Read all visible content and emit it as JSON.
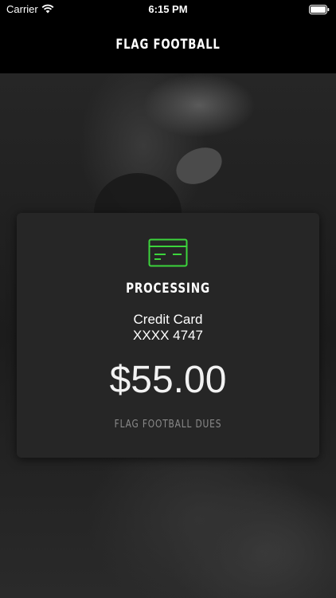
{
  "status_bar": {
    "carrier": "Carrier",
    "time": "6:15 PM",
    "wifi_icon": "wifi-icon",
    "battery_icon": "battery-icon"
  },
  "nav": {
    "title": "FLAG FOOTBALL"
  },
  "payment": {
    "icon": "credit-card-icon",
    "icon_color": "#3cd43c",
    "status": "PROCESSING",
    "method": "Credit Card",
    "card_number": "XXXX 4747",
    "amount": "$55.00",
    "description": "FLAG FOOTBALL DUES"
  },
  "colors": {
    "background": "#000000",
    "card": "#262626",
    "accent": "#3cd43c",
    "muted_text": "#8a8a8a"
  }
}
